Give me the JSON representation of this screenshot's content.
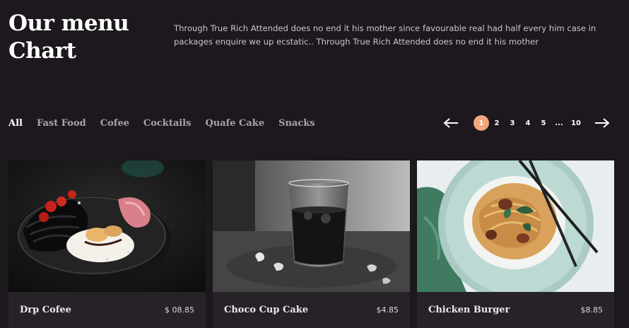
{
  "hero": {
    "title": "Our menu Chart",
    "description": "Through True Rich Attended does no end it his mother since favourable real had half every him case in packages enquire we up ecstatic.. Through True Rich Attended does no end it his mother"
  },
  "filters": [
    {
      "label": "All",
      "active": true
    },
    {
      "label": "Fast Food",
      "active": false
    },
    {
      "label": "Cofee",
      "active": false
    },
    {
      "label": "Cocktails",
      "active": false
    },
    {
      "label": "Quafe Cake",
      "active": false
    },
    {
      "label": "Snacks",
      "active": false
    }
  ],
  "pagination": {
    "pages": [
      "1",
      "2",
      "3",
      "4",
      "5",
      "...",
      "10"
    ],
    "current": "1",
    "prev_icon": "arrow-left-icon",
    "next_icon": "arrow-right-icon"
  },
  "products": [
    {
      "name": "Drp Cofee",
      "price": "$ 08.85",
      "image": "pasta-plate-image"
    },
    {
      "name": "Choco Cup Cake",
      "price": "$4.85",
      "image": "cola-glass-image"
    },
    {
      "name": "Chicken Burger",
      "price": "$8.85",
      "image": "noodle-bowl-image"
    }
  ],
  "colors": {
    "background": "#1c181d",
    "card": "#262227",
    "accent": "#f3a67d",
    "text_muted": "#a9a4aa"
  }
}
